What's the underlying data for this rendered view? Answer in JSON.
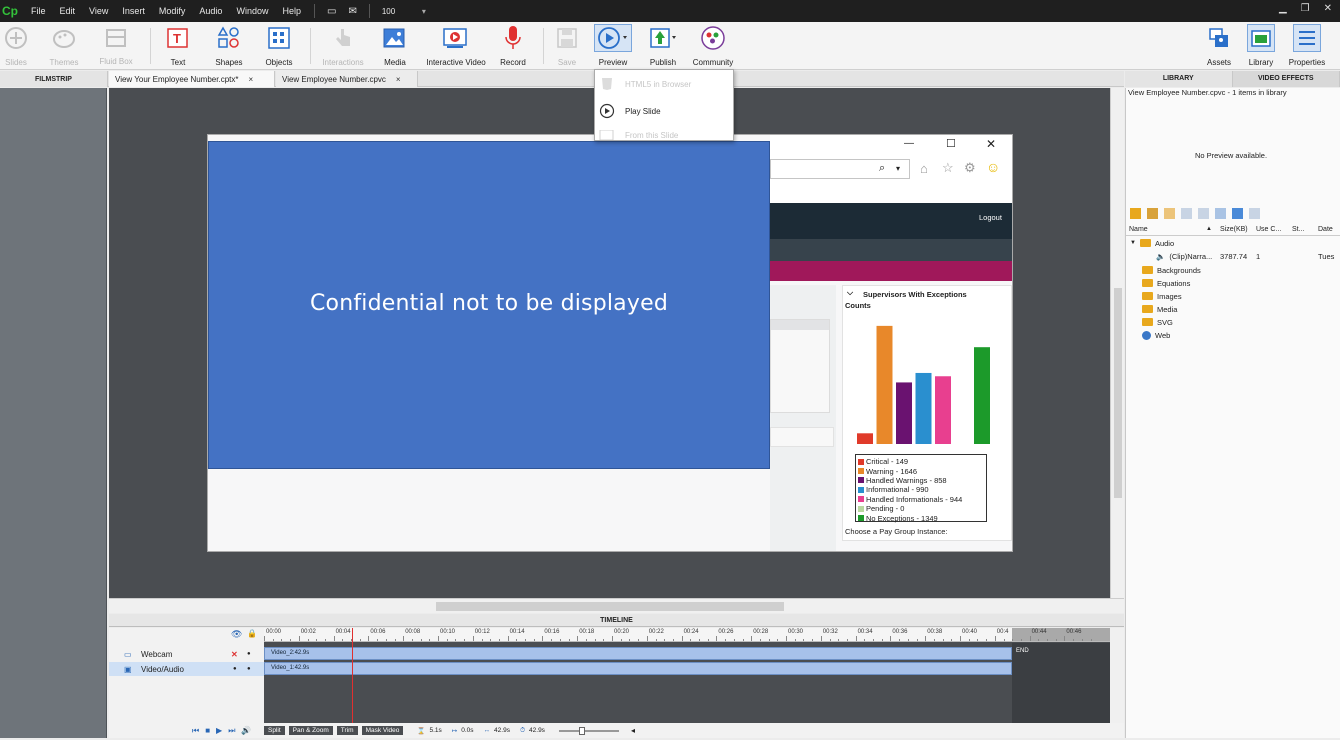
{
  "app": {
    "logo": "Cp",
    "menu": [
      "File",
      "Edit",
      "View",
      "Insert",
      "Modify",
      "Audio",
      "Window",
      "Help"
    ],
    "zoom_value": "100"
  },
  "toolbar": {
    "slides": "Slides",
    "themes": "Themes",
    "fluid_box": "Fluid Box",
    "text": "Text",
    "shapes": "Shapes",
    "objects": "Objects",
    "interactions": "Interactions",
    "media": "Media",
    "interactive_video": "Interactive Video",
    "record": "Record",
    "save": "Save",
    "preview": "Preview",
    "publish": "Publish",
    "community": "Community",
    "assets": "Assets",
    "library": "Library",
    "properties": "Properties"
  },
  "preview_menu": {
    "items": [
      "HTML5 in Browser",
      "Play Slide",
      "From this Slide"
    ]
  },
  "tabs": {
    "filmstrip": "FILMSTRIP",
    "doc1": "View Your Employee Number.cptx*",
    "doc2": "View Employee Number.cpvc",
    "close": "×"
  },
  "slide": {
    "overlay_text": "Confidential not to be displayed",
    "logout": "Logout",
    "chart_title": "Supervisors With Exceptions",
    "chart_subtitle": "Counts",
    "choose_label": "Choose a Pay Group Instance:",
    "legend": [
      {
        "label": "Critical - 149",
        "color": "#e03a2a"
      },
      {
        "label": "Warning - 1646",
        "color": "#e8882a"
      },
      {
        "label": "Handled Warnings - 858",
        "color": "#6a1270"
      },
      {
        "label": "Informational - 990",
        "color": "#2a8fcf"
      },
      {
        "label": "Handled Informationals - 944",
        "color": "#e83f8f"
      },
      {
        "label": "Pending - 0",
        "color": "#b9d8a0"
      },
      {
        "label": "No Exceptions - 1349",
        "color": "#1c9a2a"
      }
    ]
  },
  "chart_data": {
    "type": "bar",
    "title": "Supervisors With Exceptions",
    "subtitle": "Counts",
    "categories": [
      "Critical",
      "Warning",
      "Handled Warnings",
      "Informational",
      "Handled Informationals",
      "Pending",
      "No Exceptions"
    ],
    "values": [
      149,
      1646,
      858,
      990,
      944,
      0,
      1349
    ],
    "colors": [
      "#e03a2a",
      "#e8882a",
      "#6a1270",
      "#2a8fcf",
      "#e83f8f",
      "#b9d8a0",
      "#1c9a2a"
    ],
    "ylim": [
      0,
      1700
    ],
    "legend_position": "bottom"
  },
  "library": {
    "tab_library": "LIBRARY",
    "tab_effects": "VIDEO EFFECTS",
    "count": "View Employee Number.cpvc - 1 items  in library",
    "no_preview": "No Preview available.",
    "columns": [
      "Name",
      "Size(KB)",
      "Use C...",
      "St...",
      "Date"
    ],
    "audio_folder": "Audio",
    "clip": {
      "name": "(Clip)Narra...",
      "size": "3787.74",
      "use": "1",
      "date": "Tues"
    },
    "folders": [
      "Backgrounds",
      "Equations",
      "Images",
      "Media",
      "SVG",
      "Web"
    ]
  },
  "timeline": {
    "title": "TIMELINE",
    "rows": [
      "Webcam",
      "Video/Audio"
    ],
    "ticks": [
      "00:00",
      "00:02",
      "00:04",
      "00:06",
      "00:08",
      "00:10",
      "00:12",
      "00:14",
      "00:16",
      "00:18",
      "00:20",
      "00:22",
      "00:24",
      "00:26",
      "00:28",
      "00:30",
      "00:32",
      "00:34",
      "00:36",
      "00:38",
      "00:40",
      "00:4",
      "00:44",
      "00:46"
    ],
    "track_webcam": "Video_2:42.9s",
    "track_video": "Video_1:42.9s",
    "end": "END",
    "buttons": [
      "Split",
      "Pan & Zoom",
      "Trim",
      "Mask Video"
    ],
    "stats": [
      "5.1s",
      "0.0s",
      "42.9s",
      "42.9s"
    ]
  }
}
